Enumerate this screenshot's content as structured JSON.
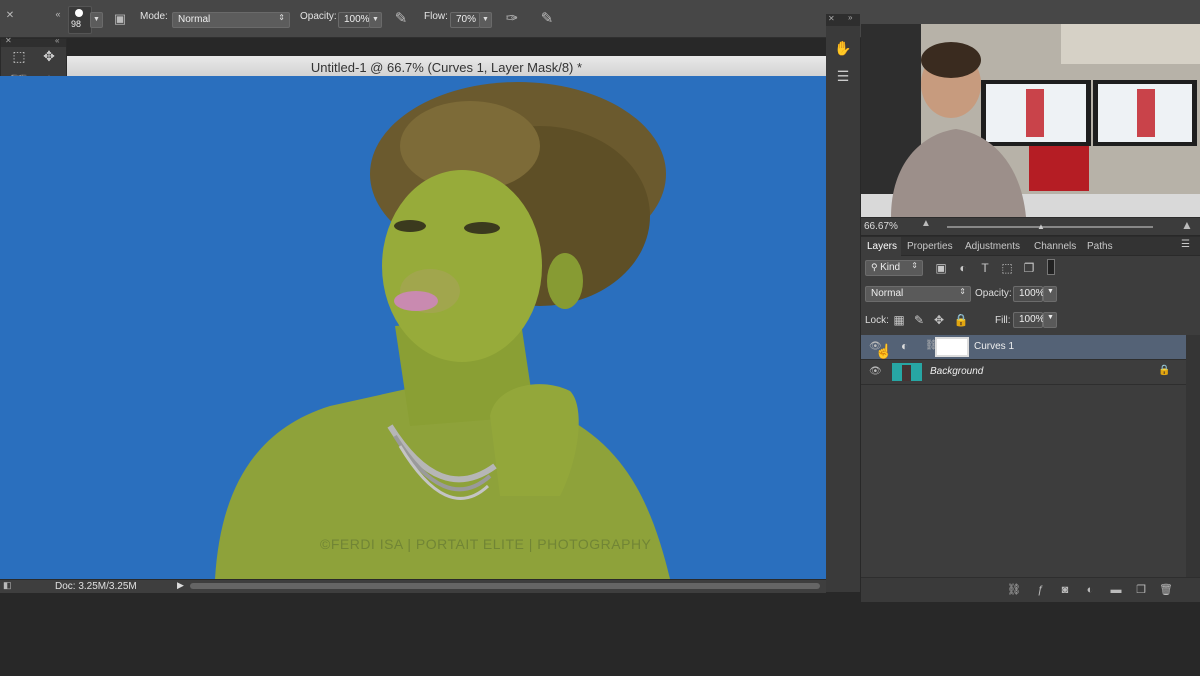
{
  "options_bar": {
    "brush_size": "98",
    "mode_label": "Mode:",
    "mode_value": "Normal",
    "opacity_label": "Opacity:",
    "opacity_value": "100%",
    "flow_label": "Flow:",
    "flow_value": "70%"
  },
  "document": {
    "title": "Untitled-1 @ 66.7% (Curves 1, Layer Mask/8) *",
    "watermark": "©FERDI ISA | PORTAIT ELITE | PHOTOGRAPHY",
    "doc_size": "Doc: 3.25M/3.25M",
    "canvas_color": "#2a6fbe"
  },
  "tools": {
    "fg_color": "#000000",
    "bg_color": "#ffffff",
    "items": [
      "marquee-icon",
      "move-icon",
      "lasso-icon",
      "magic-wand-icon",
      "crop-icon",
      "eyedropper-icon",
      "healing-icon",
      "brush-icon",
      "stamp-icon",
      "history-brush-icon",
      "eraser-icon",
      "gradient-icon",
      "blur-icon",
      "dodge-icon",
      "pen-icon",
      "type-icon",
      "path-select-icon",
      "shape-icon",
      "hand-icon",
      "zoom-icon"
    ]
  },
  "navigator": {
    "zoom": "66.67%"
  },
  "layers_panel": {
    "tabs": [
      "Layers",
      "Properties",
      "Adjustments",
      "Channels",
      "Paths"
    ],
    "filter_kind": "Kind",
    "blend_mode": "Normal",
    "opacity_label": "Opacity:",
    "opacity_value": "100%",
    "lock_label": "Lock:",
    "fill_label": "Fill:",
    "fill_value": "100%",
    "layers": [
      {
        "name": "Curves 1",
        "selected": true
      },
      {
        "name": "Background",
        "selected": false
      }
    ]
  },
  "colors": {
    "selection": "#546276",
    "panel": "#3d3d3d"
  }
}
